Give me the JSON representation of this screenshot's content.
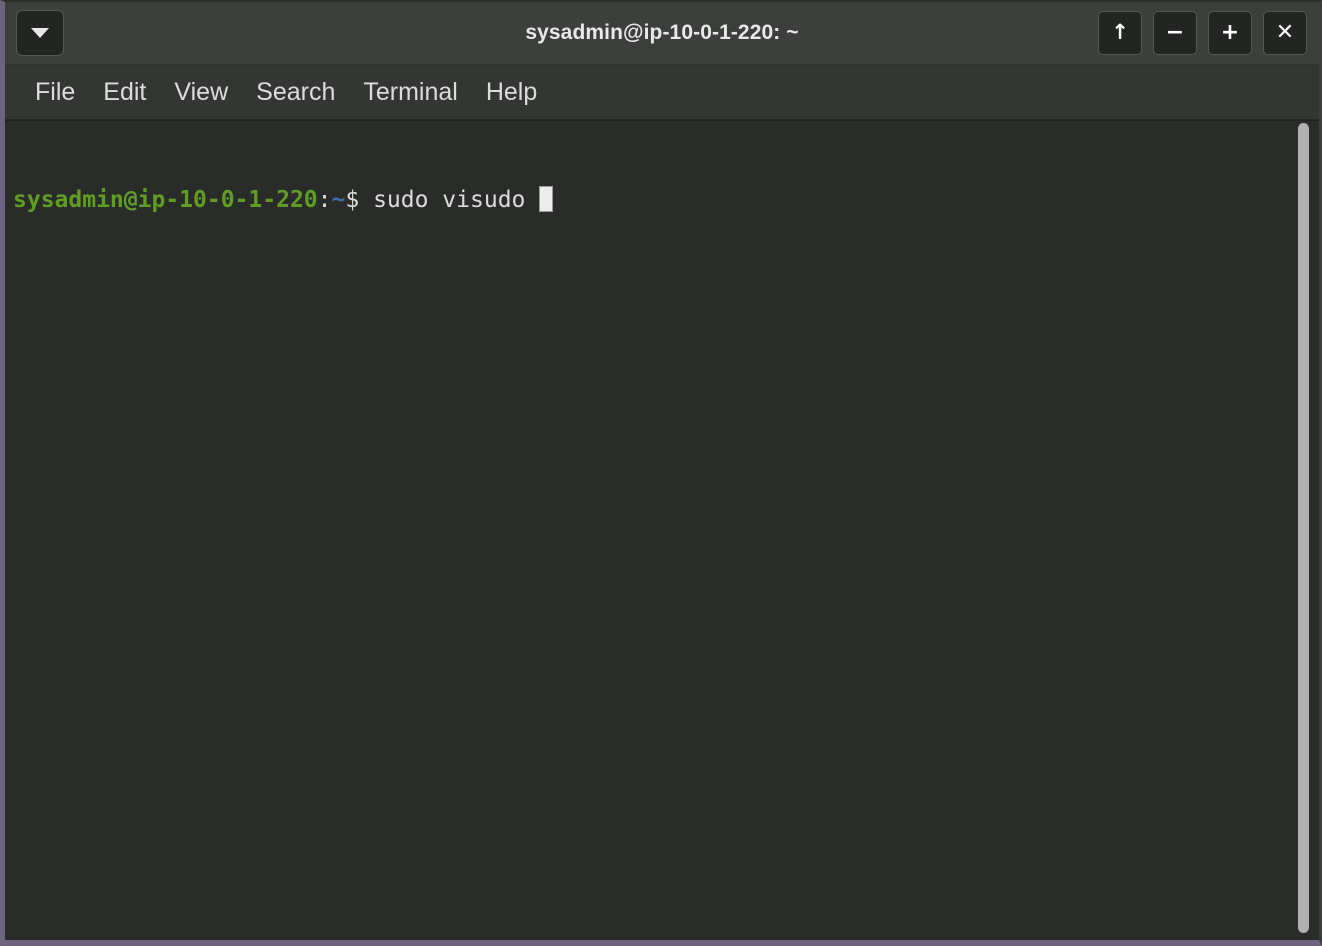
{
  "window": {
    "title": "sysadmin@ip-10-0-1-220: ~",
    "menu_button_icon": "chevron-down-icon",
    "controls": [
      {
        "name": "shade-button",
        "icon": "arrow-up-icon",
        "label": "↑"
      },
      {
        "name": "minimize-button",
        "icon": "minus-icon",
        "label": "−"
      },
      {
        "name": "maximize-button",
        "icon": "plus-icon",
        "label": "+"
      },
      {
        "name": "close-button",
        "icon": "close-icon",
        "label": "✕"
      }
    ]
  },
  "menubar": {
    "items": [
      {
        "label": "File"
      },
      {
        "label": "Edit"
      },
      {
        "label": "View"
      },
      {
        "label": "Search"
      },
      {
        "label": "Terminal"
      },
      {
        "label": "Help"
      }
    ]
  },
  "terminal": {
    "prompt_user_host": "sysadmin@ip-10-0-1-220",
    "prompt_colon": ":",
    "prompt_path": "~",
    "prompt_sigil": "$",
    "command": " sudo visudo ",
    "cursor": "block",
    "full_line": "sysadmin@ip-10-0-1-220:~$ sudo visudo "
  },
  "scrollbar": {
    "orientation": "vertical",
    "position": "right"
  },
  "colors": {
    "terminal_background": "#2a2c2a",
    "titlebar_background": "#3c3f3c",
    "menubar_background": "#333633",
    "window_border_accent": "#6e6480",
    "prompt_green": "#5f9e22",
    "prompt_blue": "#3f6fb5",
    "text_foreground": "#d6d6d6",
    "cursor_color": "#ececec",
    "scrollbar_thumb": "#b0b0b0"
  }
}
